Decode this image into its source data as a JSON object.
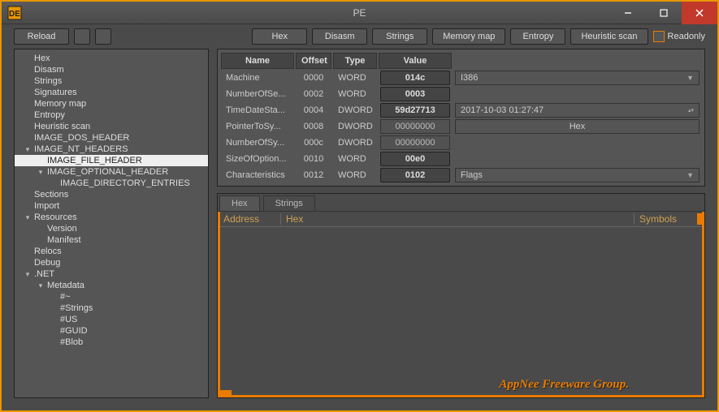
{
  "window": {
    "title": "PE"
  },
  "toolbar": {
    "reload": "Reload",
    "hex": "Hex",
    "disasm": "Disasm",
    "strings": "Strings",
    "memory_map": "Memory map",
    "entropy": "Entropy",
    "heuristic": "Heuristic scan",
    "readonly": "Readonly"
  },
  "tree": {
    "items": [
      {
        "label": "Hex",
        "depth": 0
      },
      {
        "label": "Disasm",
        "depth": 0
      },
      {
        "label": "Strings",
        "depth": 0
      },
      {
        "label": "Signatures",
        "depth": 0
      },
      {
        "label": "Memory map",
        "depth": 0
      },
      {
        "label": "Entropy",
        "depth": 0
      },
      {
        "label": "Heuristic scan",
        "depth": 0
      },
      {
        "label": "IMAGE_DOS_HEADER",
        "depth": 0
      },
      {
        "label": "IMAGE_NT_HEADERS",
        "depth": 0,
        "exp": "▾"
      },
      {
        "label": "IMAGE_FILE_HEADER",
        "depth": 1,
        "selected": true
      },
      {
        "label": "IMAGE_OPTIONAL_HEADER",
        "depth": 1,
        "exp": "▾"
      },
      {
        "label": "IMAGE_DIRECTORY_ENTRIES",
        "depth": 2
      },
      {
        "label": "Sections",
        "depth": 0
      },
      {
        "label": "Import",
        "depth": 0
      },
      {
        "label": "Resources",
        "depth": 0,
        "exp": "▾"
      },
      {
        "label": "Version",
        "depth": 1
      },
      {
        "label": "Manifest",
        "depth": 1
      },
      {
        "label": "Relocs",
        "depth": 0
      },
      {
        "label": "Debug",
        "depth": 0
      },
      {
        "label": ".NET",
        "depth": 0,
        "exp": "▾"
      },
      {
        "label": "Metadata",
        "depth": 1,
        "exp": "▾"
      },
      {
        "label": "#~",
        "depth": 2
      },
      {
        "label": "#Strings",
        "depth": 2
      },
      {
        "label": "#US",
        "depth": 2
      },
      {
        "label": "#GUID",
        "depth": 2
      },
      {
        "label": "#Blob",
        "depth": 2
      }
    ]
  },
  "grid": {
    "headers": {
      "name": "Name",
      "offset": "Offset",
      "type": "Type",
      "value": "Value"
    },
    "rows": [
      {
        "name": "Machine",
        "offset": "0000",
        "type": "WORD",
        "value": "014c",
        "extra": "I386",
        "combo": true
      },
      {
        "name": "NumberOfSe...",
        "offset": "0002",
        "type": "WORD",
        "value": "0003"
      },
      {
        "name": "TimeDateSta...",
        "offset": "0004",
        "type": "DWORD",
        "value": "59d27713",
        "extra": "2017-10-03 01:27:47",
        "spinner": true
      },
      {
        "name": "PointerToSy...",
        "offset": "0008",
        "type": "DWORD",
        "value": "00000000",
        "plain": true,
        "extra": "Hex",
        "btn": true
      },
      {
        "name": "NumberOfSy...",
        "offset": "000c",
        "type": "DWORD",
        "value": "00000000",
        "plain": true
      },
      {
        "name": "SizeOfOption...",
        "offset": "0010",
        "type": "WORD",
        "value": "00e0"
      },
      {
        "name": "Characteristics",
        "offset": "0012",
        "type": "WORD",
        "value": "0102",
        "extra": "Flags",
        "combo": true
      }
    ]
  },
  "hex": {
    "tab_hex": "Hex",
    "tab_strings": "Strings",
    "col_addr": "Address",
    "col_hex": "Hex",
    "col_sym": "Symbols"
  },
  "watermark": "AppNee Freeware Group."
}
